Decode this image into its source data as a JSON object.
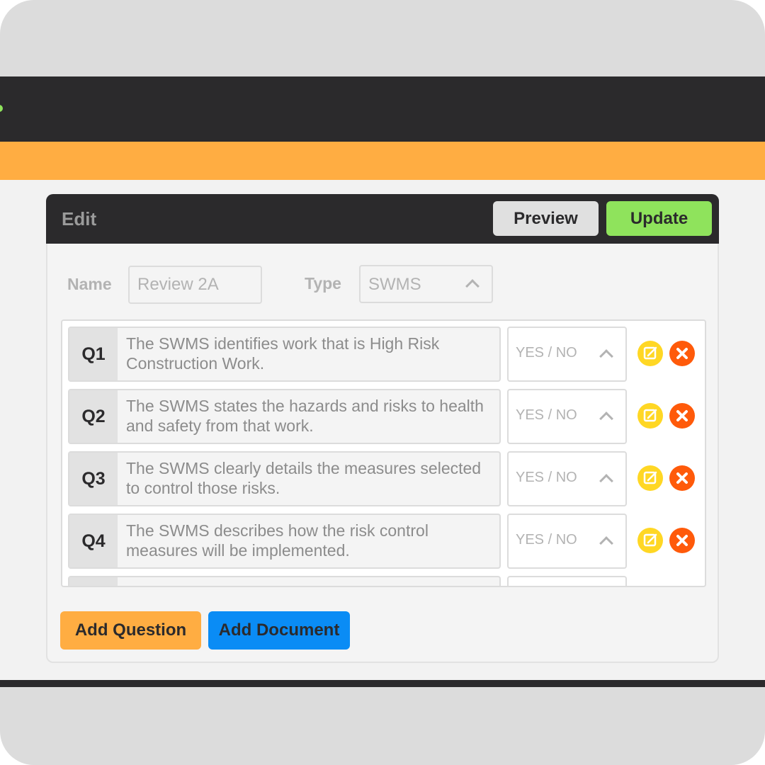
{
  "panel": {
    "title": "Edit",
    "preview_label": "Preview",
    "update_label": "Update"
  },
  "form": {
    "name_label": "Name",
    "name_value": "Review 2A",
    "type_label": "Type",
    "type_value": "SWMS"
  },
  "questions": [
    {
      "num": "Q1",
      "text": "The SWMS identifies work that is High Risk Construction Work.",
      "answer": "YES / NO"
    },
    {
      "num": "Q2",
      "text": "The SWMS states the hazards and risks to health and safety from that work.",
      "answer": "YES / NO"
    },
    {
      "num": "Q3",
      "text": "The SWMS clearly details the measures selected to control those risks.",
      "answer": "YES / NO"
    },
    {
      "num": "Q4",
      "text": "The SWMS describes how the risk control measures will be implemented.",
      "answer": "YES / NO"
    }
  ],
  "actions": {
    "add_question_label": "Add Question",
    "add_document_label": "Add Document"
  },
  "colors": {
    "dark": "#2b2a2c",
    "orange": "#ffad42",
    "green": "#8fe35c",
    "blue": "#0a8cf5",
    "edit_icon": "#ffd724",
    "delete_icon": "#ff5a0a"
  },
  "icons": {
    "edit": "edit-icon",
    "delete": "close-icon",
    "dropdown": "chevron-up-icon"
  }
}
